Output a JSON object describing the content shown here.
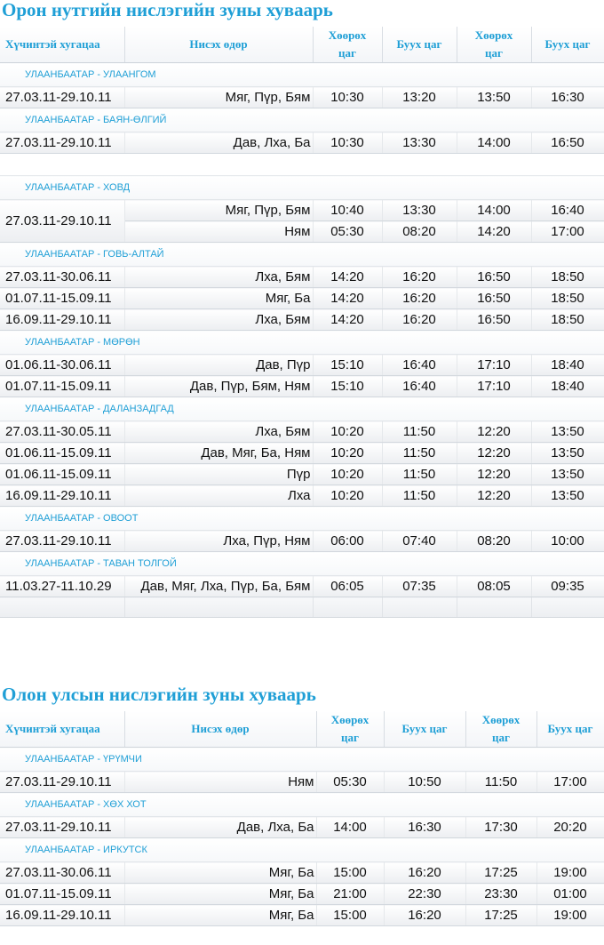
{
  "domestic": {
    "title": "Орон нутгийн нислэгийн зуны хуваарь",
    "headers": {
      "period": "Хүчинтэй хугацаа",
      "days": "Нисэх өдөр",
      "dep1_line1": "Хөөрөх",
      "dep1_line2": "цаг",
      "arr1": "Буух цаг",
      "dep2_line1": "Хөөрөх",
      "dep2_line2": "цаг",
      "arr2": "Буух цаг"
    },
    "routes": [
      {
        "name": "УЛААНБААТАР - УЛААНГОМ",
        "gap_before": false,
        "rows": [
          {
            "period": "27.03.11-29.10.11",
            "days": "Мяг, Пүр, Бям",
            "dep1": "10:30",
            "arr1": "13:20",
            "dep2": "13:50",
            "arr2": "16:30"
          }
        ]
      },
      {
        "name": "УЛААНБААТАР - БАЯН-ӨЛГИЙ",
        "gap_before": false,
        "rows": [
          {
            "period": "27.03.11-29.10.11",
            "days": "Дав, Лха, Ба",
            "dep1": "10:30",
            "arr1": "13:30",
            "dep2": "14:00",
            "arr2": "16:50"
          }
        ]
      },
      {
        "name": "УЛААНБААТАР - ХОВД",
        "gap_before": true,
        "rows": [
          {
            "period": "27.03.11-29.10.11",
            "span": 2,
            "days": "Мяг, Пүр, Бям",
            "dep1": "10:40",
            "arr1": "13:30",
            "dep2": "14:00",
            "arr2": "16:40"
          },
          {
            "days": "Ням",
            "dep1": "05:30",
            "arr1": "08:20",
            "dep2": "14:20",
            "arr2": "17:00"
          }
        ]
      },
      {
        "name": "УЛААНБААТАР - ГОВЬ-АЛТАЙ",
        "gap_before": false,
        "rows": [
          {
            "period": "27.03.11-30.06.11",
            "days": "Лха, Бям",
            "dep1": "14:20",
            "arr1": "16:20",
            "dep2": "16:50",
            "arr2": "18:50"
          },
          {
            "period": "01.07.11-15.09.11",
            "days": "Мяг, Ба",
            "dep1": "14:20",
            "arr1": "16:20",
            "dep2": "16:50",
            "arr2": "18:50"
          },
          {
            "period": "16.09.11-29.10.11",
            "days": "Лха, Бям",
            "dep1": "14:20",
            "arr1": "16:20",
            "dep2": "16:50",
            "arr2": "18:50"
          }
        ]
      },
      {
        "name": "УЛААНБААТАР - МӨРӨН",
        "gap_before": false,
        "rows": [
          {
            "period": "01.06.11-30.06.11",
            "days": "Дав, Пүр",
            "dep1": "15:10",
            "arr1": "16:40",
            "dep2": "17:10",
            "arr2": "18:40"
          },
          {
            "period": "01.07.11-15.09.11",
            "days": "Дав, Пүр, Бям, Ням",
            "dep1": "15:10",
            "arr1": "16:40",
            "dep2": "17:10",
            "arr2": "18:40"
          }
        ]
      },
      {
        "name": "УЛААНБААТАР - ДАЛАНЗАДГАД",
        "gap_before": false,
        "rows": [
          {
            "period": "27.03.11-30.05.11",
            "days": "Лха, Бям",
            "dep1": "10:20",
            "arr1": "11:50",
            "dep2": "12:20",
            "arr2": "13:50"
          },
          {
            "period": "01.06.11-15.09.11",
            "days": "Дав, Мяг, Ба, Ням",
            "dep1": "10:20",
            "arr1": "11:50",
            "dep2": "12:20",
            "arr2": "13:50"
          },
          {
            "period": "01.06.11-15.09.11",
            "days": "Пүр",
            "dep1": "10:20",
            "arr1": "11:50",
            "dep2": "12:20",
            "arr2": "13:50"
          },
          {
            "period": "16.09.11-29.10.11",
            "days": "Лха",
            "dep1": "10:20",
            "arr1": "11:50",
            "dep2": "12:20",
            "arr2": "13:50"
          }
        ]
      },
      {
        "name": "УЛААНБААТАР - ОВООТ",
        "gap_before": false,
        "rows": [
          {
            "period": "27.03.11-29.10.11",
            "days": "Лха, Пүр, Ням",
            "dep1": "06:00",
            "arr1": "07:40",
            "dep2": "08:20",
            "arr2": "10:00"
          }
        ]
      },
      {
        "name": "УЛААНБААТАР - ТАВАН ТОЛГОЙ",
        "gap_before": false,
        "rows": [
          {
            "period": "11.03.27-11.10.29",
            "days": "Дав, Мяг, Лха, Пүр, Ба, Бям",
            "dep1": "06:05",
            "arr1": "07:35",
            "dep2": "08:05",
            "arr2": "09:35"
          }
        ]
      }
    ]
  },
  "international": {
    "title": "Олон улсын нислэгийн зуны хуваарь",
    "headers": {
      "period": "Хүчинтэй хугацаа",
      "days": "Нисэх өдөр",
      "dep1_line1": "Хөөрөх",
      "dep1_line2": "цаг",
      "arr1": "Буух цаг",
      "dep2_line1": "Хөөрөх",
      "dep2_line2": "цаг",
      "arr2": "Буух цаг"
    },
    "routes": [
      {
        "name": "УЛААНБААТАР - ҮРҮМЧИ",
        "gap_before": false,
        "rows": [
          {
            "period": "27.03.11-29.10.11",
            "days": "Ням",
            "dep1": "05:30",
            "arr1": "10:50",
            "dep2": "11:50",
            "arr2": "17:00"
          }
        ]
      },
      {
        "name": "УЛААНБААТАР - ХӨХ ХОТ",
        "gap_before": false,
        "rows": [
          {
            "period": "27.03.11-29.10.11",
            "days": "Дав, Лха, Ба",
            "dep1": "14:00",
            "arr1": "16:30",
            "dep2": "17:30",
            "arr2": "20:20"
          }
        ]
      },
      {
        "name": "УЛААНБААТАР - ИРКУТСК",
        "gap_before": false,
        "rows": [
          {
            "period": "27.03.11-30.06.11",
            "days": "Мяг, Ба",
            "dep1": "15:00",
            "arr1": "16:20",
            "dep2": "17:25",
            "arr2": "19:00"
          },
          {
            "period": "01.07.11-15.09.11",
            "days": "Мяг, Ба",
            "dep1": "21:00",
            "arr1": "22:30",
            "dep2": "23:30",
            "arr2": "01:00"
          },
          {
            "period": "16.09.11-29.10.11",
            "days": "Мяг, Ба",
            "dep1": "15:00",
            "arr1": "16:20",
            "dep2": "17:25",
            "arr2": "19:00"
          }
        ]
      }
    ]
  }
}
